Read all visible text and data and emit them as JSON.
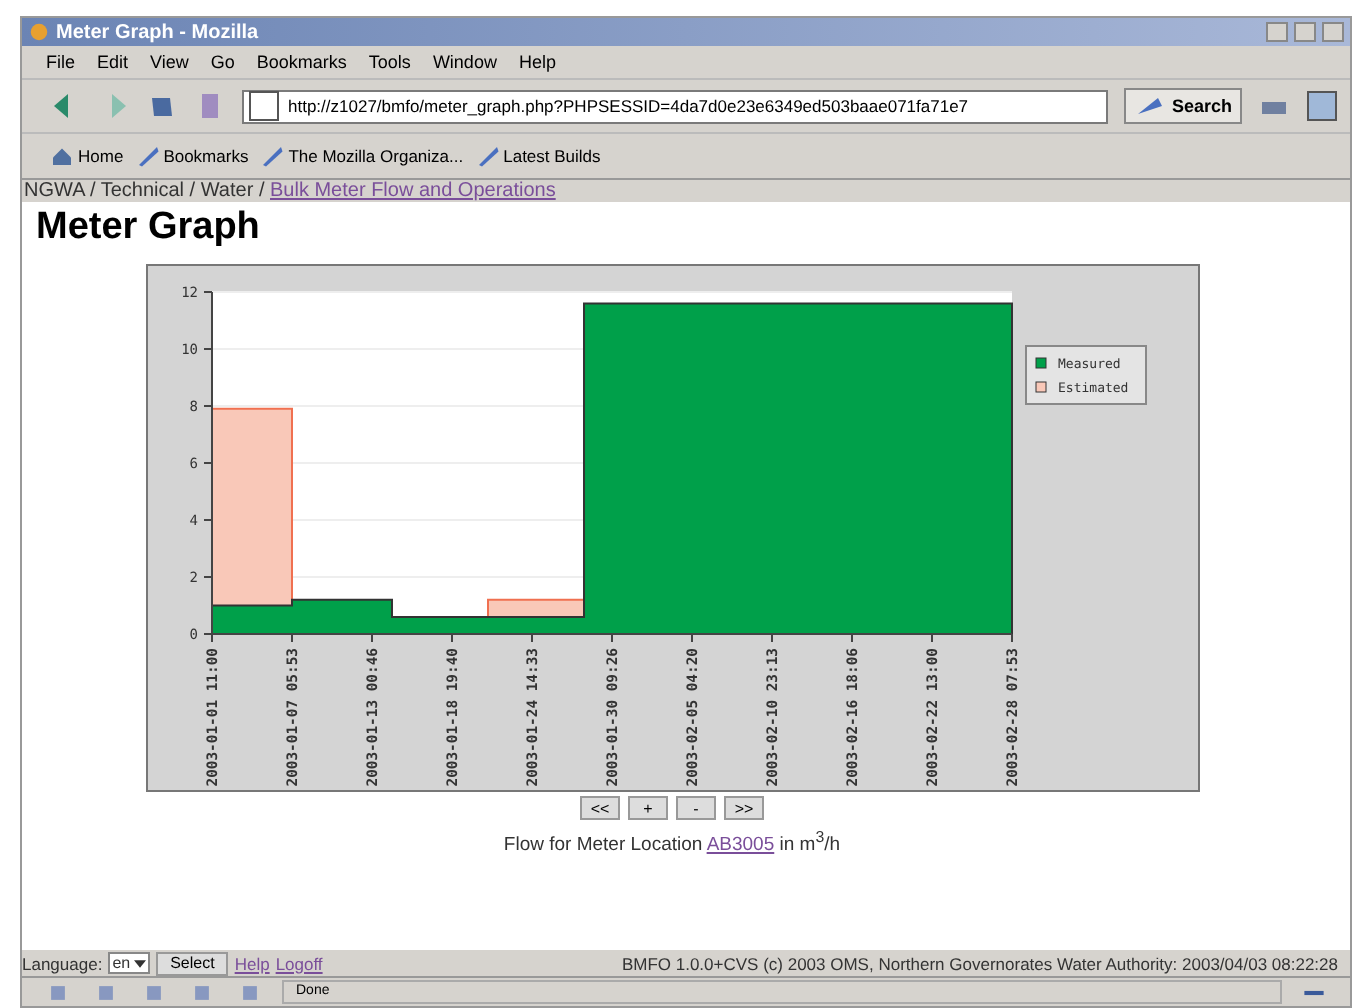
{
  "window": {
    "title": "Meter Graph - Mozilla"
  },
  "menu": [
    "File",
    "Edit",
    "View",
    "Go",
    "Bookmarks",
    "Tools",
    "Window",
    "Help"
  ],
  "address": {
    "value": "http://z1027/bmfo/meter_graph.php?PHPSESSID=4da7d0e23e6349ed503baae071fa71e7"
  },
  "search_button": "Search",
  "bookmarks": [
    "Home",
    "Bookmarks",
    "The Mozilla Organiza...",
    "Latest Builds"
  ],
  "breadcrumb": {
    "path": "NGWA / Technical / Water / ",
    "link": "Bulk Meter Flow and Operations"
  },
  "heading": "Meter Graph",
  "chart_data": {
    "type": "area",
    "grid": true,
    "legend": "right",
    "x": [
      "2003-01-01 11:00",
      "2003-01-07 05:53",
      "2003-01-07 05:53",
      "2003-01-14 11:29",
      "2003-01-14 11:29",
      "2003-01-21 10:10",
      "2003-01-21 10:10",
      "2003-01-28 08:51",
      "2003-01-28 08:51",
      "2003-02-28 07:53"
    ],
    "xlim": [
      "2003-01-01 11:00",
      "2003-02-28 07:53"
    ],
    "ylim": [
      0,
      12
    ],
    "yticks": [
      0,
      2,
      4,
      6,
      8,
      10,
      12
    ],
    "xticks": [
      "2003-01-01 11:00",
      "2003-01-07 05:53",
      "2003-01-13 00:46",
      "2003-01-18 19:40",
      "2003-01-24 14:33",
      "2003-01-30 09:26",
      "2003-02-05 04:20",
      "2003-02-10 23:13",
      "2003-02-16 18:06",
      "2003-02-22 13:00",
      "2003-02-28 07:53"
    ],
    "series": [
      {
        "name": "Measured",
        "color": "#00a04a",
        "values": [
          1,
          1,
          1.2,
          1.2,
          0.6,
          0.6,
          0.6,
          0.6,
          11.6,
          11.6
        ]
      },
      {
        "name": "Estimated",
        "color": "#f9c8b8",
        "values": [
          7.9,
          7.9,
          null,
          null,
          null,
          null,
          1.2,
          1.2,
          null,
          null
        ]
      }
    ]
  },
  "chart_nav": [
    "<<",
    "+",
    "-",
    ">>"
  ],
  "caption": {
    "before": "Flow for Meter Location",
    "link": "AB3005",
    "after": "in m$^{3}$/h"
  },
  "footer": {
    "language_label": "Language:",
    "language": "en",
    "select_button": "Select",
    "links": [
      "Help",
      "Logoff"
    ],
    "copyright": "BMFO 1.0.0+CVS (c) 2003 OMS, Northern Governorates Water Authority: 2003/04/03 08:22:28"
  },
  "status": "Done"
}
